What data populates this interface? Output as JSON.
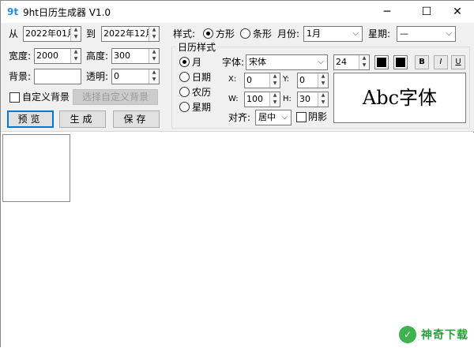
{
  "window": {
    "app_icon_glyph": "9t",
    "title": "9ht日历生成器 V1.0",
    "minimize": "─",
    "maximize": "☐",
    "close": "✕"
  },
  "left": {
    "from_label": "从",
    "from_value": "2022年01月",
    "to_label": "到",
    "to_value": "2022年12月",
    "width_label": "宽度:",
    "width_value": "2000",
    "height_label": "高度:",
    "height_value": "300",
    "background_label": "背景:",
    "background_value": "",
    "transparency_label": "透明:",
    "transparency_value": "0",
    "custom_bg_label": "自定义背景",
    "choose_bg_button": "选择自定义背景",
    "preview_button": "预览",
    "generate_button": "生成",
    "save_button": "保存"
  },
  "style": {
    "style_label": "样式:",
    "square_label": "方形",
    "strip_label": "条形",
    "month_label": "月份:",
    "month_value": "1月",
    "week_label": "星期:",
    "week_value": "—"
  },
  "calendar_style": {
    "group_label": "日历样式",
    "radio_month": "月",
    "radio_day": "日期",
    "radio_lunar": "农历",
    "radio_weekday": "星期",
    "font_label": "字体:",
    "font_value": "宋体",
    "font_size_value": "24",
    "bold_label": "B",
    "italic_label": "I",
    "underline_label": "U",
    "x_label": "X:",
    "x_value": "0",
    "y_label": "Y:",
    "y_value": "0",
    "w_label": "W:",
    "w_value": "100",
    "h_label": "H:",
    "h_value": "30",
    "align_label": "对齐:",
    "align_value": "居中",
    "shadow_label": "阴影",
    "sample_text": "Abc字体"
  },
  "watermark": {
    "logo_glyph": "✓",
    "text": "神奇下载"
  },
  "colors": {
    "accent": "#0078d7",
    "watermark": "#2d9c3e"
  }
}
